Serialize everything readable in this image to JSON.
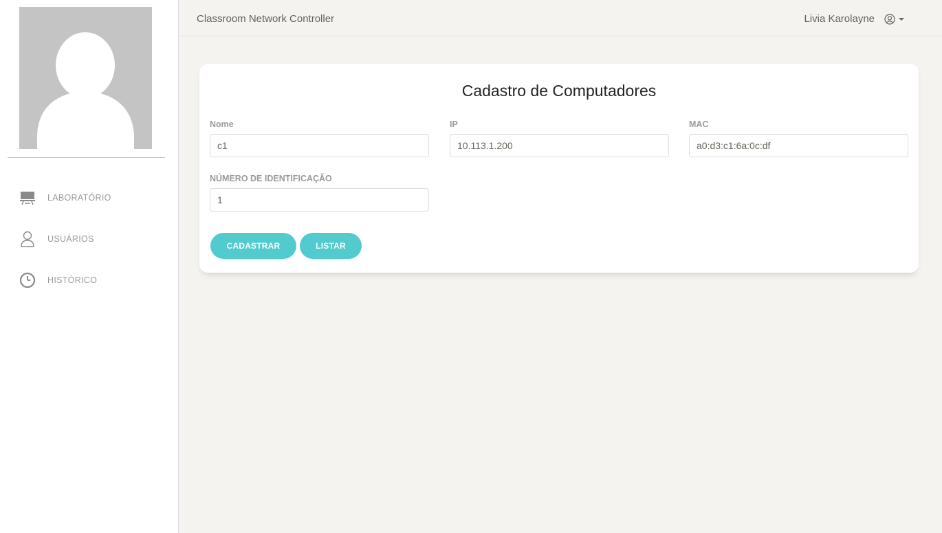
{
  "app": {
    "title": "Classroom Network Controller"
  },
  "user": {
    "name": "Livia Karolayne",
    "icon": "user-circle-icon"
  },
  "sidebar": {
    "items": [
      {
        "label": "LABORATÓRIO",
        "icon": "desk-icon"
      },
      {
        "label": "USUÁRIOS",
        "icon": "user-icon"
      },
      {
        "label": "HISTÓRICO",
        "icon": "clock-icon"
      }
    ]
  },
  "form": {
    "title": "Cadastro de Computadores",
    "fields": {
      "nome": {
        "label": "Nome",
        "value": "c1"
      },
      "ip": {
        "label": "IP",
        "value": "10.113.1.200"
      },
      "mac": {
        "label": "MAC",
        "value": "a0:d3:c1:6a:0c:df"
      },
      "numero": {
        "label": "NÚMERO DE IDENTIFICAÇÃO",
        "value": "1"
      }
    },
    "buttons": {
      "submit": "CADASTRAR",
      "list": "LISTAR"
    }
  },
  "colors": {
    "accent": "#51cbce",
    "background": "#f4f3ef",
    "text": "#66615b"
  }
}
